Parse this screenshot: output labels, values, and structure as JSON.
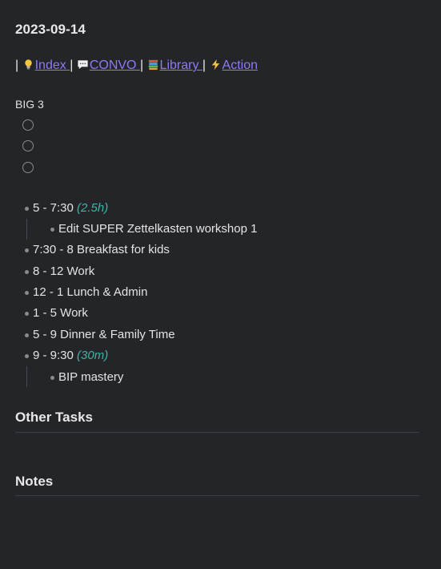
{
  "note": {
    "title": "2023-09-14",
    "links": [
      {
        "label": "Index",
        "icon": "lightbulb-icon"
      },
      {
        "label": "CONVO",
        "icon": "speech-bubble-icon"
      },
      {
        "label": "Library",
        "icon": "books-icon"
      },
      {
        "label": "Action",
        "icon": "lightning-icon"
      }
    ],
    "separator": "|",
    "big3_label": "BIG 3",
    "big3_tasks": [
      "",
      "",
      ""
    ],
    "schedule": [
      {
        "time": "5 - 7:30",
        "duration": "(2.5h)",
        "children": [
          "Edit SUPER Zettelkasten workshop 1"
        ]
      },
      {
        "time": "7:30 - 8 Breakfast for kids"
      },
      {
        "time": "8 - 12 Work"
      },
      {
        "time": "12 - 1 Lunch & Admin"
      },
      {
        "time": "1 - 5 Work"
      },
      {
        "time": "5 - 9 Dinner & Family Time"
      },
      {
        "time": "9 - 9:30",
        "duration": "(30m)",
        "children": [
          "BIP mastery"
        ]
      }
    ],
    "sections": {
      "other_tasks": "Other Tasks",
      "notes": "Notes"
    }
  },
  "colors": {
    "background": "#242529",
    "link": "#8f7bf0",
    "duration": "#3fb5a3",
    "text": "#dcddde"
  }
}
